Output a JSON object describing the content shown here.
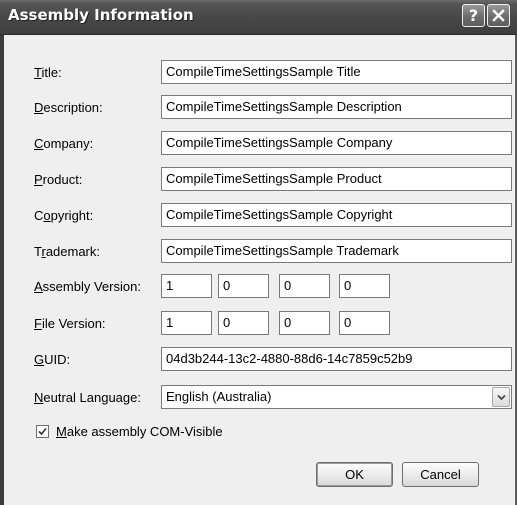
{
  "window": {
    "title": "Assembly Information",
    "help_label": "?"
  },
  "fields": {
    "title": {
      "mnemonic": "T",
      "rest": "itle:",
      "value": "CompileTimeSettingsSample Title"
    },
    "description": {
      "mnemonic": "D",
      "rest": "escription:",
      "value": "CompileTimeSettingsSample Description"
    },
    "company": {
      "mnemonic": "C",
      "rest": "ompany:",
      "value": "CompileTimeSettingsSample Company"
    },
    "product": {
      "mnemonic": "P",
      "rest": "roduct:",
      "value": "CompileTimeSettingsSample Product"
    },
    "copyright": {
      "pre": "C",
      "mnemonic": "o",
      "rest": "pyright:",
      "value": "CompileTimeSettingsSample Copyright"
    },
    "trademark": {
      "pre": "T",
      "mnemonic": "r",
      "rest": "ademark:",
      "value": "CompileTimeSettingsSample Trademark"
    },
    "guid": {
      "mnemonic": "G",
      "rest": "UID:",
      "value": "04d3b244-13c2-4880-88d6-14c7859c52b9"
    }
  },
  "assembly_version": {
    "mnemonic": "A",
    "rest": "ssembly Version:",
    "parts": [
      "1",
      "0",
      "0",
      "0"
    ]
  },
  "file_version": {
    "mnemonic": "F",
    "rest": "ile Version:",
    "parts": [
      "1",
      "0",
      "0",
      "0"
    ]
  },
  "neutral_language": {
    "mnemonic": "N",
    "rest": "eutral Language:",
    "value": "English (Australia)"
  },
  "com_visible": {
    "mnemonic": "M",
    "rest": "ake assembly COM-Visible",
    "checked": true
  },
  "buttons": {
    "ok": "OK",
    "cancel": "Cancel"
  }
}
